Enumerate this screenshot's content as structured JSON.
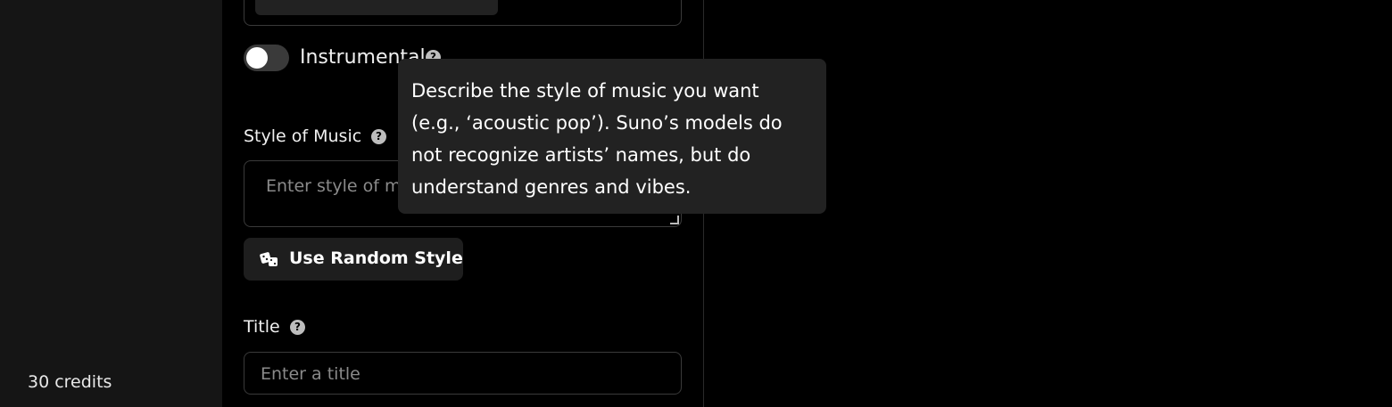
{
  "sidebar": {
    "credits": "30 credits"
  },
  "form": {
    "instrumental": {
      "label": "Instrumental",
      "enabled": false
    },
    "style_of_music": {
      "label": "Style of Music",
      "placeholder": "Enter style of mu"
    },
    "random_style_button": "Use Random Style",
    "title": {
      "label": "Title",
      "placeholder": "Enter a title"
    },
    "help_glyph": "?"
  },
  "tooltip": {
    "text": "Describe the style of music you want (e.g., ‘acoustic pop’). Suno’s models do not recognize artists’ names, but do understand genres and vibes."
  },
  "icons": {
    "help": "question-circle-icon",
    "dice": "dice-icon"
  }
}
